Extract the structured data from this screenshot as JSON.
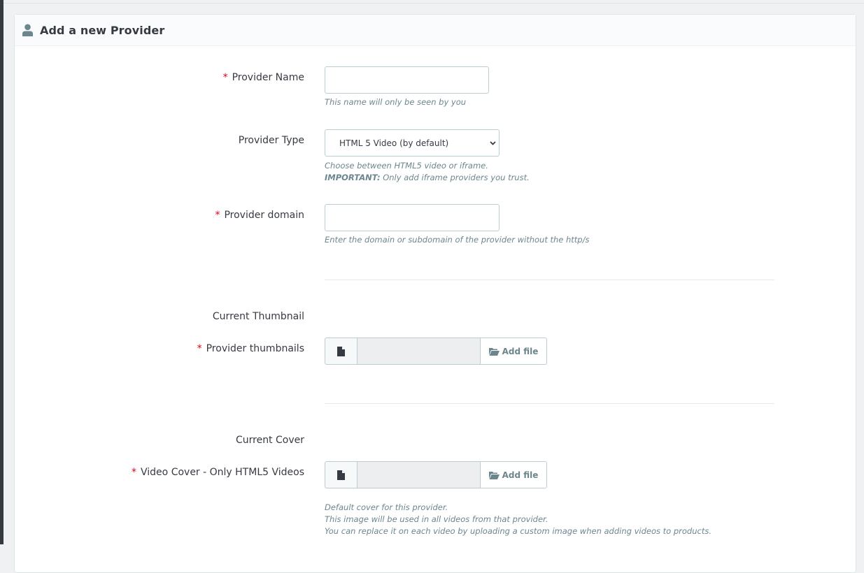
{
  "panel": {
    "title": "Add a new Provider",
    "icon": "user-icon"
  },
  "form": {
    "provider_name": {
      "label": "Provider Name",
      "required_mark": "*",
      "value": "",
      "help": "This name will only be seen by you"
    },
    "provider_type": {
      "label": "Provider Type",
      "selected": "HTML 5 Video (by default)",
      "help_line1": "Choose between HTML5 video or iframe.",
      "help_important": "IMPORTANT:",
      "help_line2": " Only add iframe providers you trust."
    },
    "provider_domain": {
      "label": "Provider domain",
      "required_mark": "*",
      "value": "",
      "help": "Enter the domain or subdomain of the provider without the http/s"
    },
    "current_thumbnail": {
      "label": "Current Thumbnail"
    },
    "provider_thumbnails": {
      "label": "Provider thumbnails",
      "required_mark": "*",
      "button": "Add file",
      "icon": "file-icon",
      "button_icon": "folder-open-icon"
    },
    "current_cover": {
      "label": "Current Cover"
    },
    "video_cover": {
      "label": "Video Cover - Only HTML5 Videos",
      "required_mark": "*",
      "button": "Add file",
      "icon": "file-icon",
      "button_icon": "folder-open-icon",
      "help_line1": "Default cover for this provider.",
      "help_line2": "This image will be used in all videos from that provider.",
      "help_line3": "You can replace it on each video by uploading a custom image when adding videos to products."
    }
  }
}
